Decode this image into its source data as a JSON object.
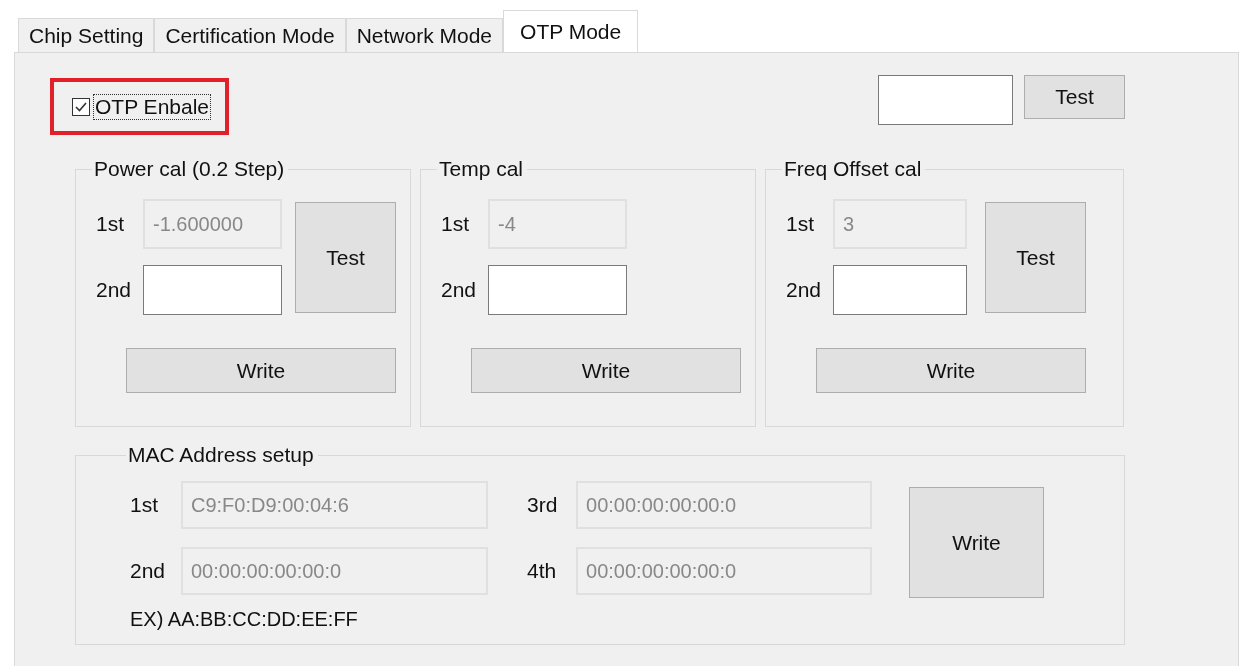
{
  "tabs": [
    {
      "label": "Chip Setting",
      "selected": false
    },
    {
      "label": "Certification Mode",
      "selected": false
    },
    {
      "label": "Network Mode",
      "selected": false
    },
    {
      "label": "OTP Mode",
      "selected": true
    }
  ],
  "otp_enable": {
    "label": "OTP Enbale",
    "checked": true,
    "focused": true,
    "highlighted": true
  },
  "top_test": {
    "field": {
      "disabled": false
    },
    "button": "Test"
  },
  "cal_groups": [
    {
      "title": "Power cal (0.2 Step)",
      "fields": [
        {
          "label": "1st",
          "value": "-1.600000",
          "disabled": true
        },
        {
          "label": "2nd",
          "disabled": false
        }
      ],
      "test_button": "Test",
      "write_button": "Write"
    },
    {
      "title": "Temp cal",
      "fields": [
        {
          "label": "1st",
          "value": "-4",
          "disabled": true
        },
        {
          "label": "2nd",
          "disabled": false
        }
      ],
      "write_button": "Write"
    },
    {
      "title": "Freq Offset cal",
      "fields": [
        {
          "label": "1st",
          "value": "3",
          "disabled": true
        },
        {
          "label": "2nd",
          "disabled": false
        }
      ],
      "test_button": "Test",
      "write_button": "Write"
    }
  ],
  "mac": {
    "title": "MAC Address setup",
    "fields": [
      {
        "label": "1st",
        "value": "C9:F0:D9:00:04:6",
        "disabled": true
      },
      {
        "label": "3rd",
        "value": "00:00:00:00:00:0",
        "disabled": true
      },
      {
        "label": "2nd",
        "value": "00:00:00:00:00:0",
        "disabled": true
      },
      {
        "label": "4th",
        "value": "00:00:00:00:00:0",
        "disabled": true
      }
    ],
    "write_button": "Write",
    "example": "EX) AA:BB:CC:DD:EE:FF"
  }
}
